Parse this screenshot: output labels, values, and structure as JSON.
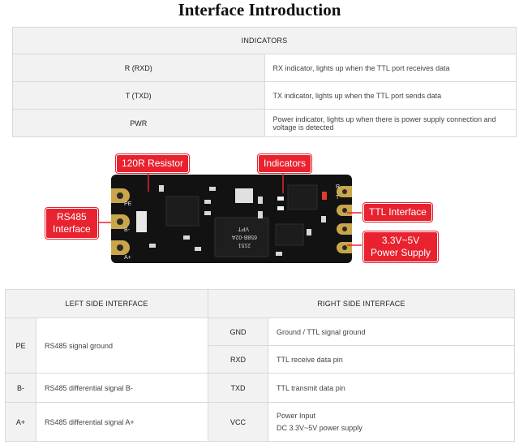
{
  "title": "Interface Introduction",
  "indicators": {
    "header": "INDICATORS",
    "rows": [
      {
        "key": "R (RXD)",
        "desc": "RX indicator, lights up when the TTL port receives data"
      },
      {
        "key": "T (TXD)",
        "desc": "TX indicator, lights up when the TTL port sends data"
      },
      {
        "key": "PWR",
        "desc": "Power indicator, lights up when there is power supply connection and voltage is detected"
      }
    ]
  },
  "board": {
    "callouts": {
      "resistor": "120R Resistor",
      "indicators": "Indicators",
      "rs485_line1": "RS485",
      "rs485_line2": "Interface",
      "ttl": "TTL Interface",
      "power_line1": "3.3V~5V",
      "power_line2": "Power Supply"
    },
    "silkscreen": {
      "pe": "PE",
      "bminus": "B-",
      "aplus": "A+",
      "chip_line1": "VPT",
      "chip_line2": "658B-02A",
      "chip_line3": "2151",
      "r": "R",
      "t": "T"
    },
    "colors": {
      "pcb": "#121212",
      "callout": "#e8222f",
      "gold": "#c9a64a"
    }
  },
  "interfaces": {
    "left_header": "LEFT SIDE INTERFACE",
    "right_header": "RIGHT SIDE INTERFACE",
    "left": [
      {
        "key": "PE",
        "desc": "RS485 signal ground"
      },
      {
        "key": "B-",
        "desc": "RS485 differential signal B-"
      },
      {
        "key": "A+",
        "desc": "RS485 differential signal A+"
      }
    ],
    "right": [
      {
        "key": "GND",
        "desc": "Ground / TTL signal ground"
      },
      {
        "key": "RXD",
        "desc": "TTL receive data pin"
      },
      {
        "key": "TXD",
        "desc": "TTL transmit data pin"
      },
      {
        "key": "VCC",
        "desc_line1": "Power Input",
        "desc_line2": "DC 3.3V~5V power supply"
      }
    ]
  }
}
